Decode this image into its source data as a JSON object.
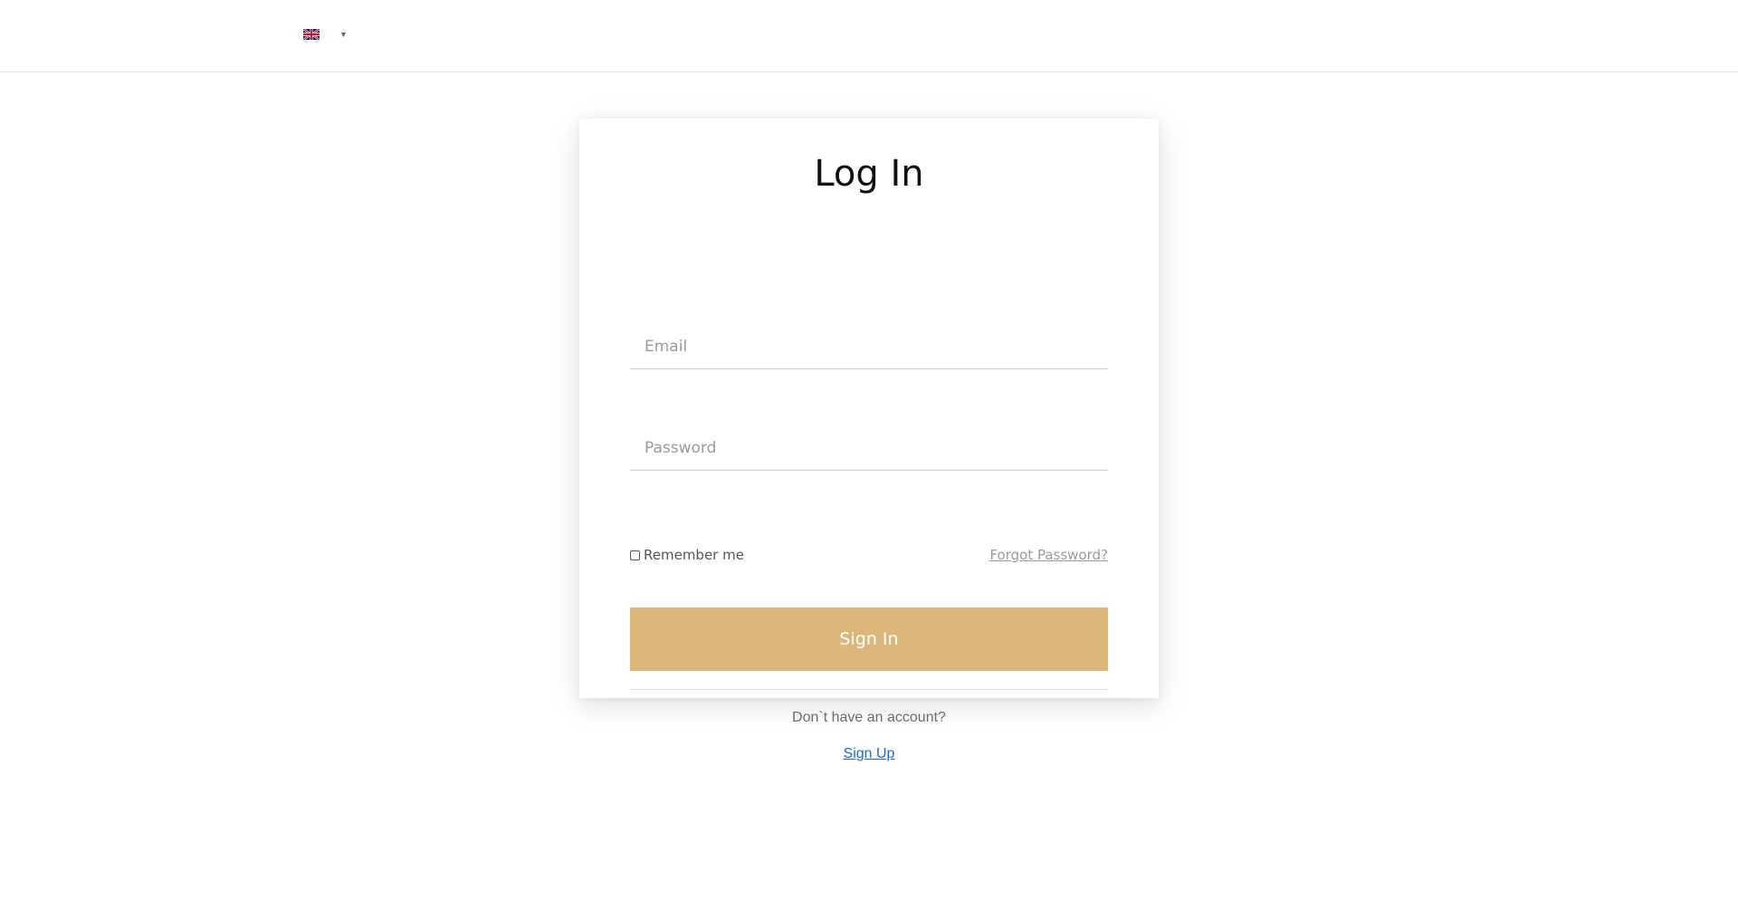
{
  "header": {
    "language_icon": "uk-flag-icon",
    "language_caret": "▼"
  },
  "login": {
    "title": "Log In",
    "email_placeholder": "Email",
    "password_placeholder": "Password",
    "remember_label": "Remember me",
    "forgot_label": "Forgot Password?",
    "signin_label": "Sign In",
    "no_account_text": "Don`t have an account?",
    "signup_label": "Sign Up"
  },
  "colors": {
    "signin_button": "#dbb77b",
    "link": "#1e6bc6"
  }
}
